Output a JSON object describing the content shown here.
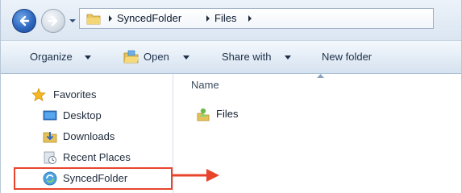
{
  "address_bar": {
    "breadcrumbs": [
      "SyncedFolder",
      "Files"
    ],
    "icons": {
      "back": "back-arrow-icon",
      "forward": "forward-arrow-icon",
      "folder": "folder-icon"
    }
  },
  "command_bar": {
    "organize": "Organize",
    "open": "Open",
    "share_with": "Share with",
    "new_folder": "New folder"
  },
  "nav_pane": {
    "favorites": "Favorites",
    "items": [
      {
        "label": "Desktop",
        "icon": "desktop-icon"
      },
      {
        "label": "Downloads",
        "icon": "downloads-icon"
      },
      {
        "label": "Recent Places",
        "icon": "recent-places-icon"
      },
      {
        "label": "SyncedFolder",
        "icon": "synced-folder-icon",
        "highlighted": true
      }
    ]
  },
  "content": {
    "column_header": "Name",
    "files": [
      {
        "label": "Files",
        "icon": "shared-folder-icon"
      }
    ]
  },
  "colors": {
    "highlight": "#e8442c",
    "accent": "#2f68c0"
  }
}
